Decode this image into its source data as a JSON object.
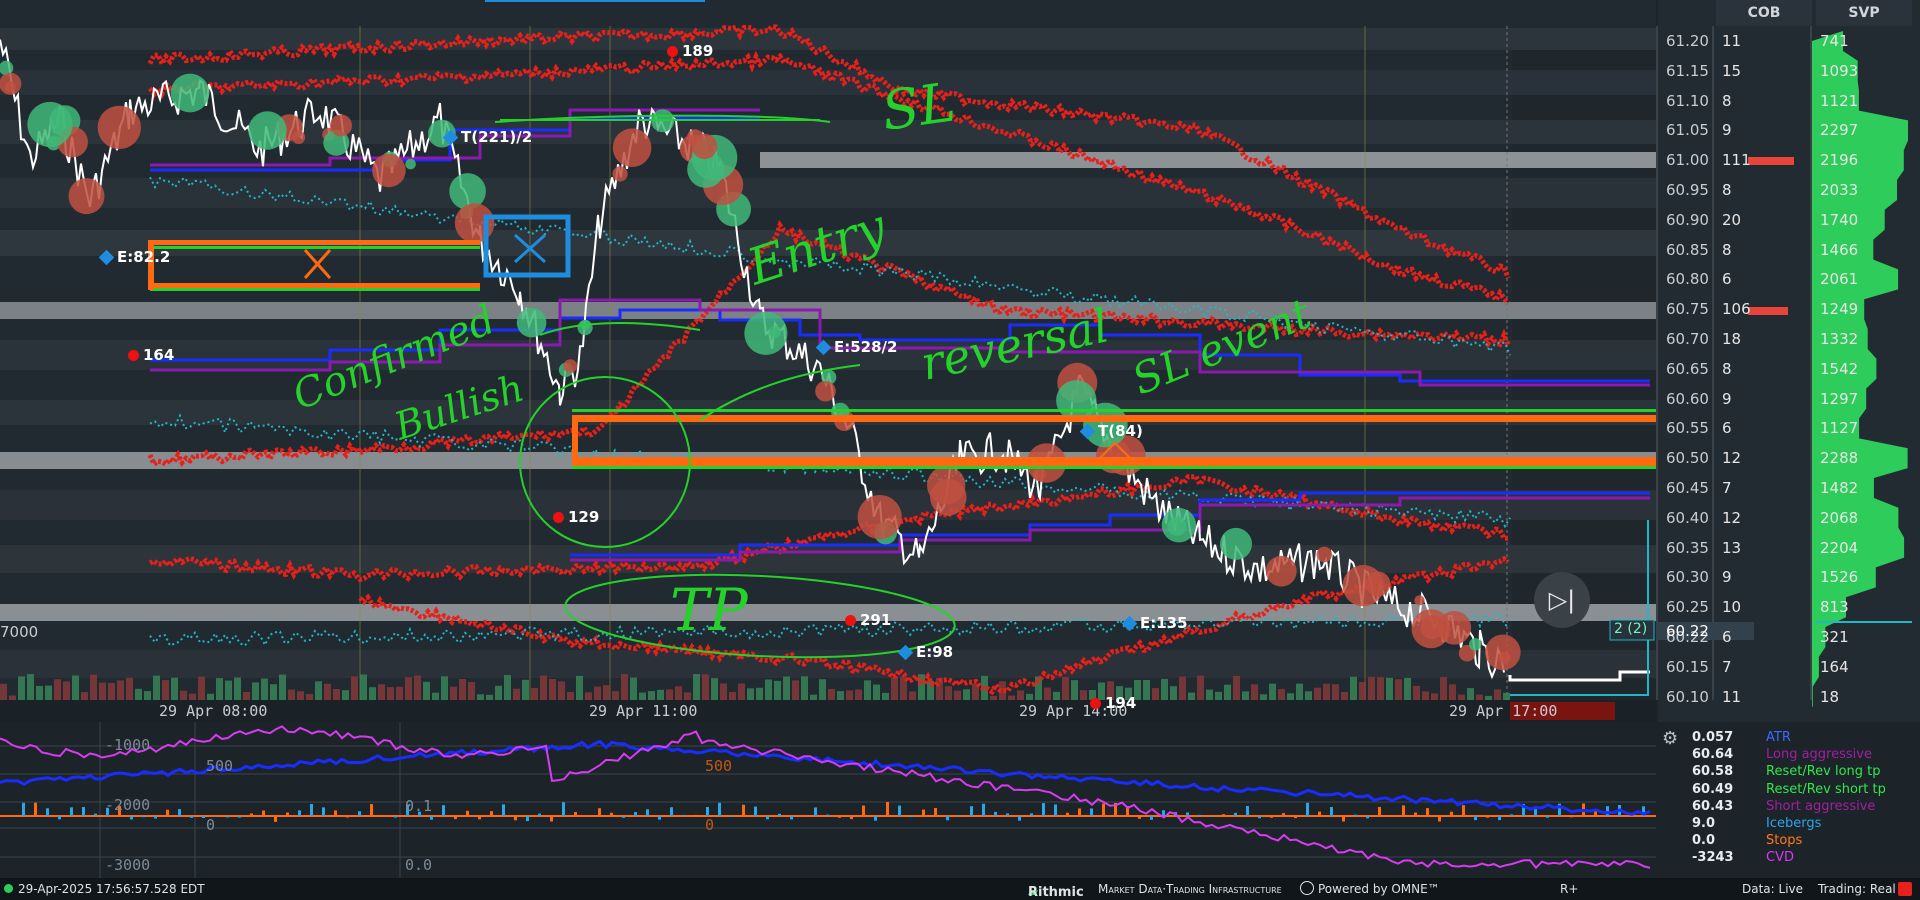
{
  "top_bar": {
    "accent": "#1e8de0"
  },
  "ladder": {
    "cob_header": "COB",
    "svp_header": "SVP",
    "rows": [
      {
        "price": "61.20",
        "cob": "11",
        "svp": "741"
      },
      {
        "price": "61.15",
        "cob": "15",
        "svp": "1093"
      },
      {
        "price": "61.10",
        "cob": "8",
        "svp": "1121"
      },
      {
        "price": "61.05",
        "cob": "9",
        "svp": "2297"
      },
      {
        "price": "61.00",
        "cob": "111",
        "svp": "2196"
      },
      {
        "price": "60.95",
        "cob": "8",
        "svp": "2033"
      },
      {
        "price": "60.90",
        "cob": "20",
        "svp": "1740"
      },
      {
        "price": "60.85",
        "cob": "8",
        "svp": "1466"
      },
      {
        "price": "60.80",
        "cob": "6",
        "svp": "2061"
      },
      {
        "price": "60.75",
        "cob": "106",
        "svp": "1249"
      },
      {
        "price": "60.70",
        "cob": "18",
        "svp": "1332"
      },
      {
        "price": "60.65",
        "cob": "8",
        "svp": "1542"
      },
      {
        "price": "60.60",
        "cob": "9",
        "svp": "1297"
      },
      {
        "price": "60.55",
        "cob": "6",
        "svp": "1127"
      },
      {
        "price": "60.50",
        "cob": "12",
        "svp": "2288"
      },
      {
        "price": "60.45",
        "cob": "7",
        "svp": "1482"
      },
      {
        "price": "60.40",
        "cob": "12",
        "svp": "2068"
      },
      {
        "price": "60.35",
        "cob": "13",
        "svp": "2204"
      },
      {
        "price": "60.30",
        "cob": "9",
        "svp": "1526"
      },
      {
        "price": "60.25",
        "cob": "10",
        "svp": "813"
      },
      {
        "price": "60.22",
        "cob": "6",
        "svp": "321"
      },
      {
        "price": "60.15",
        "cob": "7",
        "svp": "164"
      },
      {
        "price": "60.10",
        "cob": "11",
        "svp": "18"
      }
    ],
    "current_price": "60.22",
    "position_label": "2 (2)"
  },
  "time_axis": [
    "29 Apr 08:00",
    "29 Apr 11:00",
    "29 Apr 14:00",
    "29 Apr 17:00"
  ],
  "left_axis_label": "7000",
  "markers": {
    "m189": "189",
    "m164": "164",
    "m129": "129",
    "m291": "291",
    "m194": "194",
    "e82": "E:82.2",
    "t221": "T(221)/2",
    "e528": "E:528/2",
    "t84": "T(84)",
    "e135": "E:135",
    "e98": "E:98"
  },
  "annotations": {
    "sl": "SL",
    "entry": "Entry",
    "reversal": "reversal",
    "sl_event": "SL event",
    "confirmed": "Confirmed",
    "bullish": "Bullish",
    "tp": "TP"
  },
  "lower_axis": [
    "-1000",
    "-2000",
    "-3000",
    "500",
    "0",
    "500",
    "0",
    "0.1",
    "0.0"
  ],
  "legend": [
    {
      "value": "0.057",
      "name": "ATR",
      "color": "#3a6bff"
    },
    {
      "value": "60.64",
      "name": "Long aggressive",
      "color": "#a020a0"
    },
    {
      "value": "60.58",
      "name": "Reset/Rev long tp",
      "color": "#2ee84a"
    },
    {
      "value": "60.49",
      "name": "Reset/Rev short tp",
      "color": "#2ee84a"
    },
    {
      "value": "60.43",
      "name": "Short aggressive",
      "color": "#a020a0"
    },
    {
      "value": "9.0",
      "name": "Icebergs",
      "color": "#2aa7e8"
    },
    {
      "value": "0.0",
      "name": "Stops",
      "color": "#ff7a1a"
    },
    {
      "value": "-3243",
      "name": "CVD",
      "color": "#d83cf0"
    }
  ],
  "status": {
    "timestamp": "29-Apr-2025 17:56:57.528 EDT",
    "brand": "Rithmic",
    "tagline": "Market Data·Trading Infrastructure",
    "powered": "Powered by OMNE™",
    "rplus": "R+",
    "data_live": "Data: Live",
    "trading_real": "Trading: Real"
  },
  "colors": {
    "background": "#1c2329",
    "price_line": "#ffffff",
    "stops": "#e8201a",
    "levels_orange": "#ff6a10",
    "annotation_green": "#25d12a",
    "blue_line": "#1a2dff",
    "teal": "#21b6c8"
  }
}
